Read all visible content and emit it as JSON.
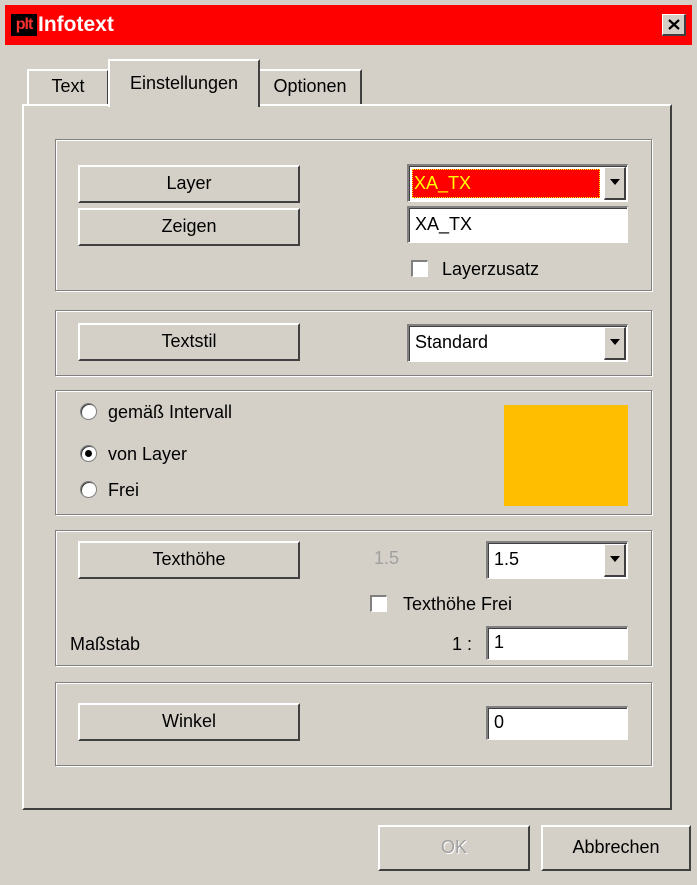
{
  "window": {
    "title": "Infotext",
    "app_icon_text": "plt"
  },
  "tabs": [
    {
      "label": "Text"
    },
    {
      "label": "Einstellungen"
    },
    {
      "label": "Optionen"
    }
  ],
  "layer_group": {
    "layer_button": "Layer",
    "zeigen_button": "Zeigen",
    "layer_dropdown_value": "XA_TX",
    "layer_text_value": "XA_TX",
    "layerzusatz_label": "Layerzusatz",
    "layerzusatz_checked": false,
    "highlight_color": "#ff0000"
  },
  "textstil_group": {
    "textstil_button": "Textstil",
    "textstil_value": "Standard"
  },
  "color_group": {
    "options": [
      {
        "label": "gemäß Intervall",
        "checked": false
      },
      {
        "label": "von Layer",
        "checked": true
      },
      {
        "label": "Frei",
        "checked": false
      }
    ],
    "swatch_color": "#ffbf00"
  },
  "texthoehe_group": {
    "texthoehe_button": "Texthöhe",
    "disabled_value": "1.5",
    "dropdown_value": "1.5",
    "texthoehe_frei_label": "Texthöhe Frei",
    "texthoehe_frei_checked": false,
    "massstab_label": "Maßstab",
    "massstab_prefix": "1 :",
    "massstab_value": "1"
  },
  "winkel_group": {
    "winkel_button": "Winkel",
    "winkel_value": "0"
  },
  "footer": {
    "ok_label": "OK",
    "cancel_label": "Abbrechen"
  }
}
